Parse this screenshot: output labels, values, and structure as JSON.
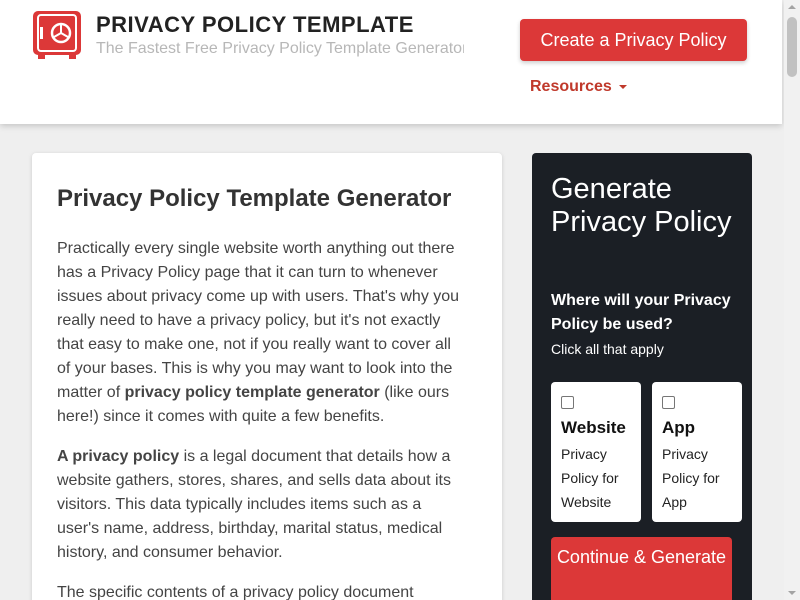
{
  "header": {
    "site_title": "PRIVACY POLICY TEMPLATE",
    "tagline": "The Fastest Free Privacy Policy Template Generator",
    "cta_label": "Create a Privacy Policy",
    "resources_label": "Resources",
    "logo_icon": "safe-icon"
  },
  "article": {
    "title": "Privacy Policy Template Generator",
    "p1_a": "Practically every single website worth anything out there has a Privacy Policy page that it can turn to whenever issues about privacy come up with users. That's why you really need to have a privacy policy, but it's not exactly that easy to make one, not if you really want to cover all of your bases. This is why you may want to look into the matter of ",
    "p1_bold": "privacy policy template generator",
    "p1_b": " (like ours here!) since it comes with quite a few benefits.",
    "p2_bold": "A privacy policy",
    "p2_a": " is a legal document that details how a website gathers, stores, shares, and sells data about its visitors. This data typically includes items such as a user's name, address, birthday, marital status, medical history, and consumer behavior.",
    "p3": "The specific contents of a privacy policy document"
  },
  "sidebar": {
    "title": "Generate Privacy Policy",
    "question": "Where will your Privacy Policy be used?",
    "hint": "Click all that apply",
    "options": [
      {
        "title": "Website",
        "desc": "Privacy Policy for Website"
      },
      {
        "title": "App",
        "desc": "Privacy Policy for App"
      }
    ],
    "continue_label": "Continue & Generate"
  },
  "colors": {
    "accent_red": "#dc3838",
    "sidebar_bg": "#1b1f25",
    "link_red": "#c0392b"
  }
}
